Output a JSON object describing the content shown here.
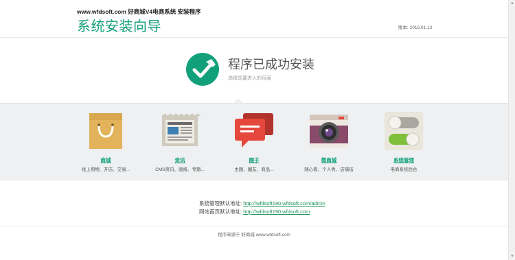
{
  "header": {
    "site_line": "www.wfdsoft.com 好商城V4电商系统 安装程序",
    "wizard_title": "系统安装向导",
    "version": "版本: 2016.01.13"
  },
  "success": {
    "title": "程序已成功安装",
    "subtitle": "选择您要进入的页面"
  },
  "entries": [
    {
      "label": "商城",
      "desc": "线上购物、开店、交易...",
      "icon": "shopping-bag-icon"
    },
    {
      "label": "资讯",
      "desc": "CMS资讯、画报、专题...",
      "icon": "newspaper-icon"
    },
    {
      "label": "圈子",
      "desc": "主题、圈友、商品...",
      "icon": "chat-bubbles-icon"
    },
    {
      "label": "微商城",
      "desc": "随心看、个人秀、店铺街",
      "icon": "camera-icon"
    },
    {
      "label": "系统管理",
      "desc": "电商系统后台",
      "icon": "toggle-switches-icon"
    }
  ],
  "links": {
    "admin_label": "系统管理默认地址:",
    "admin_url": "http://wfdsoft190.wfdsoft.com/admin",
    "site_label": "网站首页默认地址:",
    "site_url": "http://wfdsoft190.wfdsoft.com"
  },
  "footer": {
    "text": "程序来源于 好商城 www.wfdsoft.com"
  },
  "colors": {
    "accent": "#12a07a",
    "band": "#eef0f1",
    "link": "#1a8f5a"
  }
}
